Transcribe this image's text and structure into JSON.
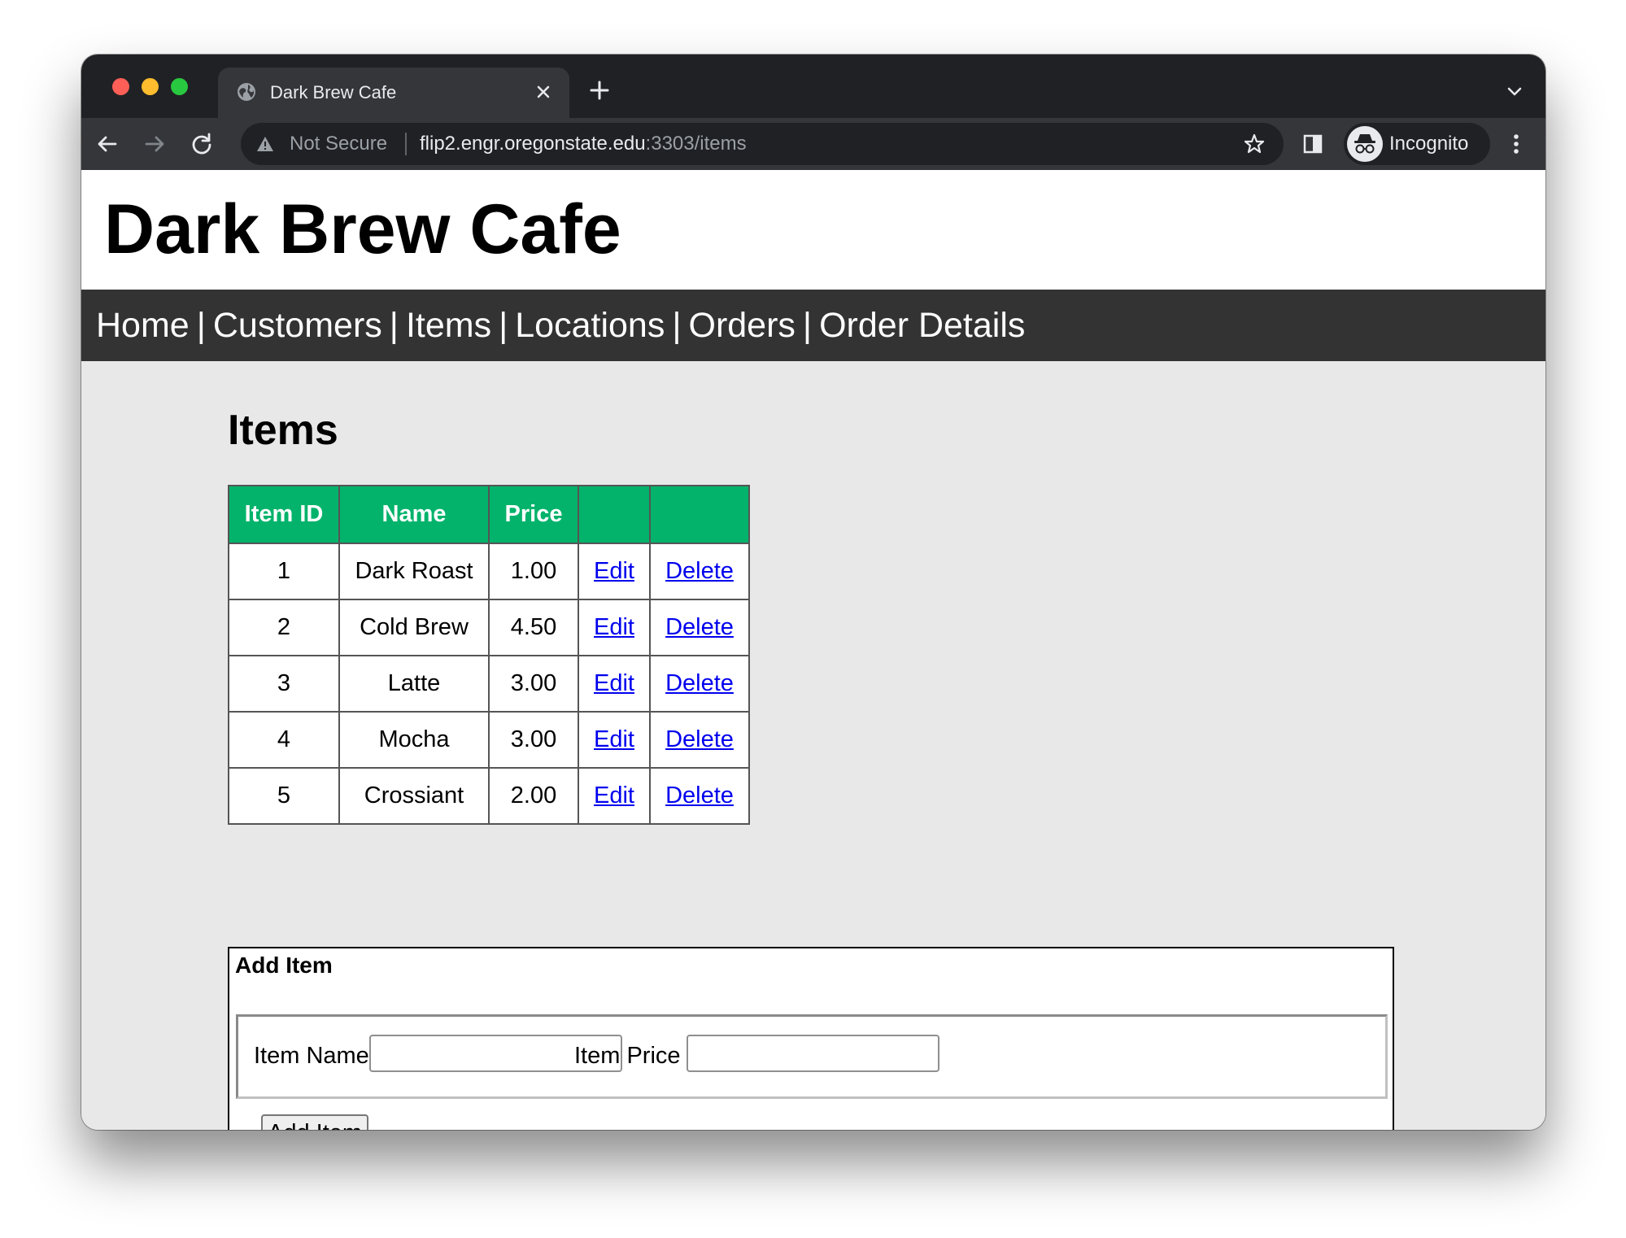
{
  "browser": {
    "tab_title": "Dark Brew Cafe",
    "security_label": "Not Secure",
    "url_host": "flip2.engr.oregonstate.edu",
    "url_rest": ":3303/items",
    "profile_label": "Incognito"
  },
  "site": {
    "title": "Dark Brew Cafe",
    "nav": [
      "Home",
      "Customers",
      "Items",
      "Locations",
      "Orders",
      "Order Details"
    ],
    "nav_separator": "|"
  },
  "items": {
    "heading": "Items",
    "columns": [
      "Item ID",
      "Name",
      "Price",
      "",
      ""
    ],
    "rows": [
      {
        "id": "1",
        "name": "Dark Roast",
        "price": "1.00",
        "edit": "Edit",
        "delete": "Delete"
      },
      {
        "id": "2",
        "name": "Cold Brew",
        "price": "4.50",
        "edit": "Edit",
        "delete": "Delete"
      },
      {
        "id": "3",
        "name": "Latte",
        "price": "3.00",
        "edit": "Edit",
        "delete": "Delete"
      },
      {
        "id": "4",
        "name": "Mocha",
        "price": "3.00",
        "edit": "Edit",
        "delete": "Delete"
      },
      {
        "id": "5",
        "name": "Crossiant",
        "price": "2.00",
        "edit": "Edit",
        "delete": "Delete"
      }
    ]
  },
  "add_item": {
    "title": "Add Item",
    "name_label": "Item Name",
    "name_value": "",
    "price_label": "Item Price",
    "price_value": "",
    "button_label": "Add Item"
  },
  "colors": {
    "table_header": "#03b36b",
    "navbar": "#333333",
    "link": "#0000ee"
  }
}
